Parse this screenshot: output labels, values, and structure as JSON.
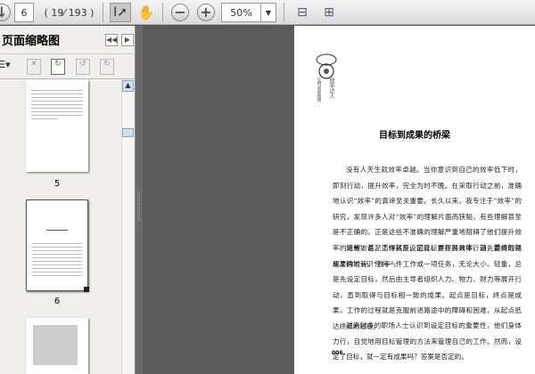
{
  "toolbar": {
    "current_page": "6",
    "page_count": "( 19⁄ 193 )",
    "zoom": "50%",
    "icons": [
      "next-page-icon",
      "select-tool-icon",
      "hand-tool-icon",
      "zoom-out-icon",
      "zoom-in-icon",
      "fit-width-icon",
      "fit-page-icon"
    ]
  },
  "sidebar": {
    "title": "页面缩略图",
    "thumbnails": [
      {
        "label": "5"
      },
      {
        "label": "6"
      }
    ]
  },
  "page": {
    "header_vertical": "效率达人",
    "header_sub": "让时间更值钱",
    "title": "目标到成果的桥梁",
    "paragraphs": [
      "没有人天生就效率卓越。当你意识到自己的效率低下时，即刻行动，提升效率，完全为时不晚。在采取行动之前，准确地认识“效率”的真谛至关重要。长久以来，我专注于“效率”的研究，发现许多人对“效率”的理解片面而狭隘，有些理解甚至是不正确的。正是这些不准确的理解严重地阻碍了他们提升效率的进程，甚至适得其反。因此，要提升效率，首先要做的就是准确地认识“效率”。",
      "简单地说，工作就是设定目标并开展具体行动，最终取得成果的过程。任何一件工作或一项任务，无论大小、轻重，总是先设定目标，然后由主导者组织人力、物力、财力等展开行动，直到取得与目标相一致的成果。起点是目标，终点是成果，工作的过程就是克服前进路途中的障碍和困难，从起点抵达终点的过程。",
      "越来越多的职场人士认识到设定目标的重要性，他们身体力行，自觉地用目标管理的方法来管理自己的工作。然而，设定了目标，就一定有成果吗？答案是否定的。"
    ],
    "page_number": "006"
  }
}
